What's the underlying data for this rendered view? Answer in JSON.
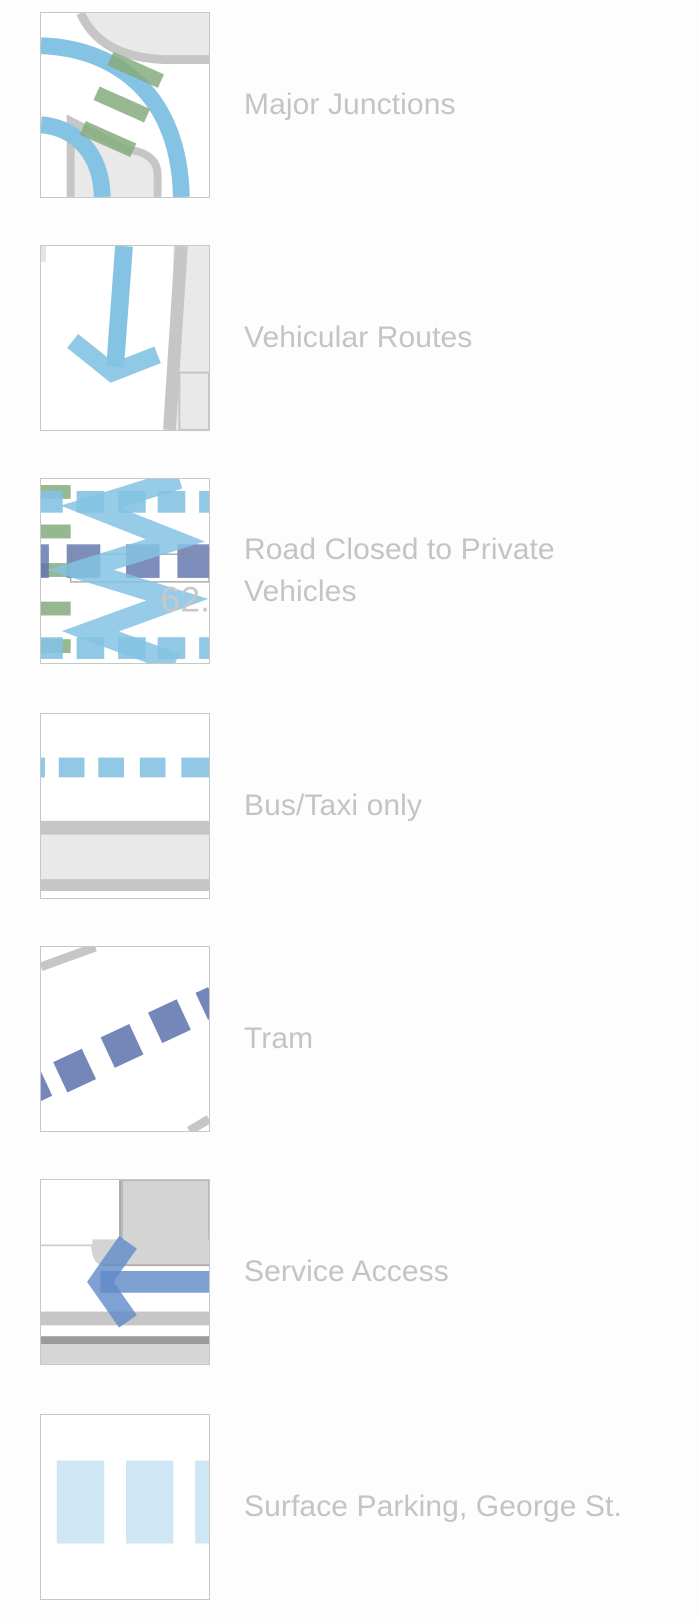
{
  "legend": {
    "items": [
      {
        "key": "major-junctions",
        "label": "Major Junctions",
        "icon": "major-junctions-icon"
      },
      {
        "key": "vehicular-routes",
        "label": "Vehicular Routes",
        "icon": "vehicular-routes-icon"
      },
      {
        "key": "road-closed",
        "label": "Road Closed to Private Vehicles",
        "icon": "road-closed-icon",
        "swatch_text": "62."
      },
      {
        "key": "bus-taxi",
        "label": "Bus/Taxi only",
        "icon": "bus-taxi-icon"
      },
      {
        "key": "tram",
        "label": "Tram",
        "icon": "tram-icon"
      },
      {
        "key": "service-access",
        "label": "Service Access",
        "icon": "service-access-icon"
      },
      {
        "key": "surface-parking",
        "label": "Surface Parking, George St.",
        "icon": "surface-parking-icon"
      }
    ]
  },
  "colors": {
    "vehicular_blue": "#7cc0e3",
    "tram_blue": "#5d73ad",
    "service_blue": "#5f89c9",
    "green": "#83aa7d",
    "road_gray": "#c6c6c6",
    "block_gray": "#e9e9e9",
    "parking_blue": "#cfe7f4",
    "label_gray": "#c4c4c4",
    "border_gray": "#c7c7c7"
  }
}
